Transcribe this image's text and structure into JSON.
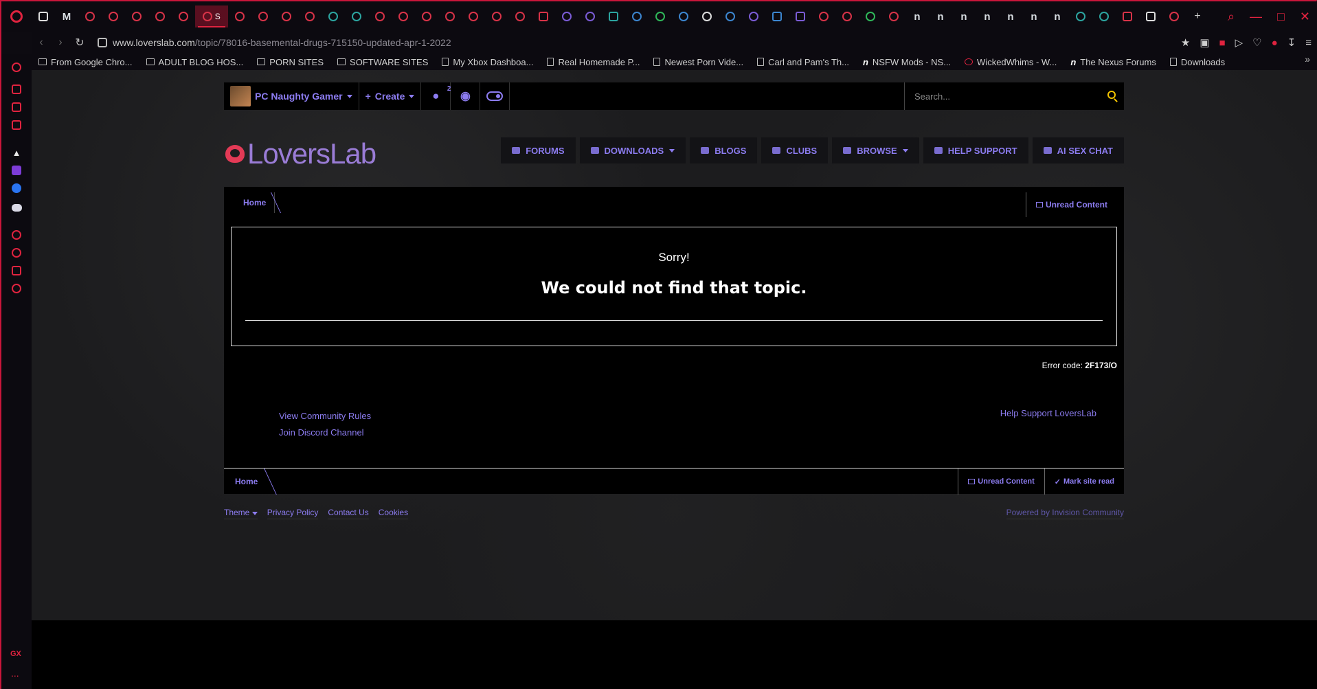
{
  "browser": {
    "url_domain": "www.loverslab.com",
    "url_path": "/topic/78016-basemental-drugs-715150-updated-apr-1-2022",
    "tab_badge": "S",
    "gx_label": "GX",
    "more_label": "...",
    "win_controls": [
      "⌕",
      "—",
      "□",
      "✕"
    ]
  },
  "bookmarks": [
    {
      "label": "From Google Chro...",
      "icon": "folder-icon"
    },
    {
      "label": "ADULT BLOG HOS...",
      "icon": "folder-icon"
    },
    {
      "label": "PORN SITES",
      "icon": "folder-icon"
    },
    {
      "label": "SOFTWARE SITES",
      "icon": "folder-icon"
    },
    {
      "label": "My Xbox Dashboa...",
      "icon": "page-icon"
    },
    {
      "label": "Real Homemade P...",
      "icon": "page-icon"
    },
    {
      "label": "Newest Porn Vide...",
      "icon": "page-icon"
    },
    {
      "label": "Carl and Pam's Th...",
      "icon": "page-icon"
    },
    {
      "label": "NSFW Mods - NS...",
      "icon": "nexus-icon"
    },
    {
      "label": "WickedWhims - W...",
      "icon": "heart-icon"
    },
    {
      "label": "The Nexus Forums",
      "icon": "nexus-icon"
    },
    {
      "label": "Downloads",
      "icon": "page-icon"
    }
  ],
  "userbar": {
    "username": "PC Naughty Gamer",
    "create_label": "Create",
    "notifications_count": "2",
    "search_placeholder": "Search..."
  },
  "site": {
    "logo_text": "LoversLab",
    "nav": [
      "FORUMS",
      "DOWNLOADS",
      "BLOGS",
      "CLUBS",
      "BROWSE",
      "HELP SUPPORT",
      "AI SEX CHAT"
    ]
  },
  "breadcrumb": {
    "home": "Home",
    "unread": "Unread Content",
    "mark_read": "Mark site read"
  },
  "error": {
    "sorry": "Sorry!",
    "message": "We could not find that topic.",
    "code_label": "Error code:",
    "code_value": "2F173/O"
  },
  "links": {
    "rules": "View Community Rules",
    "discord": "Join Discord Channel",
    "support": "Help Support LoversLab"
  },
  "footer": {
    "theme": "Theme",
    "privacy": "Privacy Policy",
    "contact": "Contact Us",
    "cookies": "Cookies",
    "powered": "Powered by Invision Community"
  }
}
